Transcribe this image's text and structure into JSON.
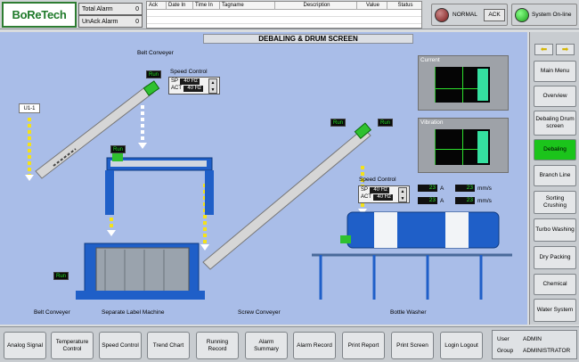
{
  "header": {
    "logo": "BoReTech",
    "total_alarm_label": "Total Alarm",
    "total_alarm_value": "0",
    "unack_alarm_label": "UnAck Alarm",
    "unack_alarm_value": "0",
    "alarm_columns": [
      "Ack",
      "Date In",
      "Time In",
      "Tagname",
      "Description",
      "Value",
      "Status"
    ],
    "normal_label": "NORMAL",
    "ack_label": "ACK",
    "online_label": "System On-line"
  },
  "page_title": "DEBALING & DRUM SCREEN",
  "scene": {
    "belt_conveyer_top": "Belt Conveyer",
    "u1_label": "U1-1",
    "run_label": "Run",
    "speed_control_label": "Speed Control",
    "sp_label": "SP",
    "act_label": "ACT",
    "speed1_sp": "40 Hz",
    "speed1_act": "40 Hz",
    "speed2_sp": "40 Hz",
    "speed2_act": "40 Hz",
    "current_label": "Current",
    "vibration_label": "Vibration",
    "readouts": [
      {
        "value": "23",
        "unit": "A"
      },
      {
        "value": "23",
        "unit": "mm/s"
      },
      {
        "value": "23",
        "unit": "A"
      },
      {
        "value": "23",
        "unit": "mm/s"
      }
    ],
    "captions": {
      "belt_conveyer": "Belt Conveyer",
      "separate_label_machine": "Separate Label Machine",
      "screw_conveyer": "Screw Conveyer",
      "bottle_washer": "Bottle Washer"
    }
  },
  "nav": {
    "items": [
      {
        "label": "Main Menu",
        "active": false
      },
      {
        "label": "Overview",
        "active": false
      },
      {
        "label": "Debaling Drum screen",
        "active": false
      },
      {
        "label": "Debaling",
        "active": true
      },
      {
        "label": "Branch Line",
        "active": false
      },
      {
        "label": "Sorting Crushing",
        "active": false
      },
      {
        "label": "Turbo Washing",
        "active": false
      },
      {
        "label": "Dry Packing",
        "active": false
      },
      {
        "label": "Chemical",
        "active": false
      },
      {
        "label": "Water System",
        "active": false
      }
    ]
  },
  "bottom": {
    "buttons": [
      "Analog Signal",
      "Temperature Control",
      "Speed Control",
      "Trend Chart",
      "Running Record",
      "Alarm Summary",
      "Alarm Record",
      "Print Report",
      "Print Screen",
      "Login Logout"
    ],
    "user_label": "User",
    "user_value": "ADMIN",
    "group_label": "Group",
    "group_value": "ADMINISTRATOR"
  },
  "colors": {
    "accent_green": "#1bc41b",
    "background_blue": "#a9bde8",
    "machine_blue": "#1f5fc8",
    "flow_yellow": "#f4e21a"
  },
  "icons": [
    "arrow-left-icon",
    "arrow-right-icon",
    "normal-lamp-icon",
    "online-lamp-icon"
  ]
}
